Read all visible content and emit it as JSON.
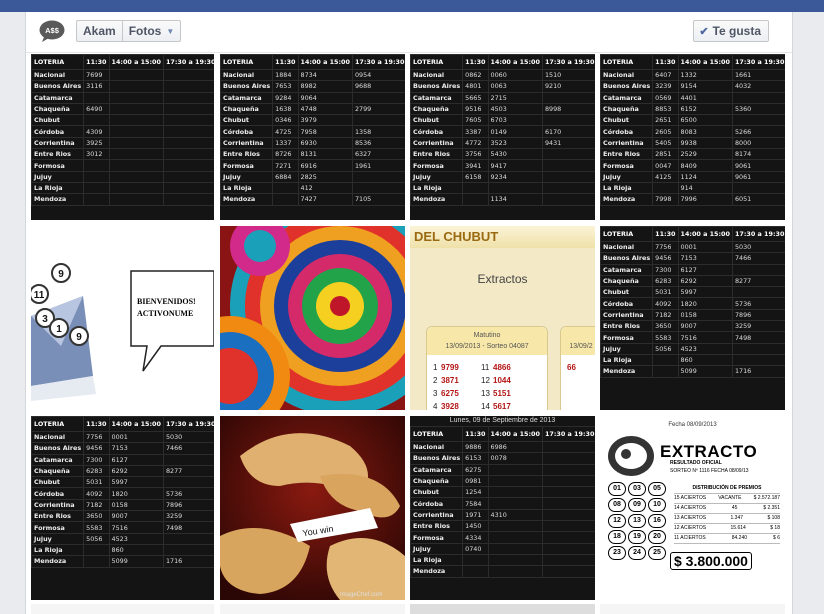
{
  "header": {
    "logo_text": "A$$",
    "page_name": "Akam",
    "section": "Fotos",
    "like_label": "Te gusta"
  },
  "lottery_header": [
    "LOTERIA",
    "11:30",
    "14:00 a 15:00",
    "17:30 a 19:30",
    "21:00 a 22:30"
  ],
  "lottery_tables": [
    {
      "rows": [
        [
          "Nacional",
          "7699",
          "",
          "",
          ""
        ],
        [
          "Buenos Aires",
          "3116",
          "",
          "",
          ""
        ],
        [
          "Catamarca",
          "",
          "",
          "",
          ""
        ],
        [
          "Chaqueña",
          "6490",
          "",
          "",
          ""
        ],
        [
          "Chubut",
          "",
          "",
          "",
          ""
        ],
        [
          "Córdoba",
          "4309",
          "",
          "",
          ""
        ],
        [
          "Corrientina",
          "3925",
          "",
          "",
          ""
        ],
        [
          "Entre Rios",
          "3012",
          "",
          "",
          ""
        ],
        [
          "Formosa",
          "",
          "",
          "",
          ""
        ],
        [
          "Jujuy",
          "",
          "",
          "",
          ""
        ],
        [
          "La Rioja",
          "",
          "",
          "",
          ""
        ],
        [
          "Mendoza",
          "",
          "",
          "",
          ""
        ]
      ]
    },
    {
      "rows": [
        [
          "Nacional",
          "1884",
          "8734",
          "0954",
          "2289"
        ],
        [
          "Buenos Aires",
          "7653",
          "8982",
          "9688",
          "1701"
        ],
        [
          "Catamarca",
          "9284",
          "9064",
          "",
          "7698"
        ],
        [
          "Chaqueña",
          "1638",
          "4748",
          "2799",
          "4817"
        ],
        [
          "Chubut",
          "0346",
          "3979",
          "",
          "8611"
        ],
        [
          "Córdoba",
          "4725",
          "7958",
          "1358",
          "16749"
        ],
        [
          "Corrientina",
          "1337",
          "6930",
          "8536",
          "8021"
        ],
        [
          "Entre Rios",
          "8726",
          "8131",
          "6327",
          "4035"
        ],
        [
          "Formosa",
          "7271",
          "6916",
          "1961",
          "9540"
        ],
        [
          "Jujuy",
          "6884",
          "2825",
          "",
          "1557"
        ],
        [
          "La Rioja",
          "",
          "412",
          "",
          "311"
        ],
        [
          "Mendoza",
          "",
          "7427",
          "7105",
          "0293"
        ]
      ]
    },
    {
      "rows": [
        [
          "Nacional",
          "0862",
          "0060",
          "1510",
          "3221"
        ],
        [
          "Buenos Aires",
          "4801",
          "0063",
          "9210",
          "6784"
        ],
        [
          "Catamarca",
          "5665",
          "2715",
          "",
          "6085"
        ],
        [
          "Chaqueña",
          "9516",
          "4503",
          "8998",
          "5519"
        ],
        [
          "Chubut",
          "7605",
          "6703",
          "",
          "1828"
        ],
        [
          "Córdoba",
          "3387",
          "0149",
          "6170",
          "2385"
        ],
        [
          "Corrientina",
          "4772",
          "3523",
          "9431",
          "4990"
        ],
        [
          "Entre Rios",
          "3756",
          "5430",
          "",
          "7803"
        ],
        [
          "Formosa",
          "3941",
          "9417",
          "",
          "9993"
        ],
        [
          "Jujuy",
          "6158",
          "9234",
          "",
          "8112"
        ],
        [
          "La Rioja",
          "",
          "",
          "",
          "0800"
        ],
        [
          "Mendoza",
          "",
          "1134",
          "",
          "3918"
        ]
      ]
    },
    {
      "rows": [
        [
          "Nacional",
          "6407",
          "1332",
          "1661",
          "9012"
        ],
        [
          "Buenos Aires",
          "3239",
          "9154",
          "4032",
          "9713"
        ],
        [
          "Catamarca",
          "0569",
          "4401",
          "",
          "2172"
        ],
        [
          "Chaqueña",
          "8853",
          "6152",
          "5360",
          "9044"
        ],
        [
          "Chubut",
          "2651",
          "6500",
          "",
          "6361"
        ],
        [
          "Córdoba",
          "2605",
          "8083",
          "5266",
          "9347"
        ],
        [
          "Corrientina",
          "5405",
          "9938",
          "8000",
          "0393"
        ],
        [
          "Entre Rios",
          "2851",
          "2529",
          "8174",
          "0373"
        ],
        [
          "Formosa",
          "0047",
          "8409",
          "9061",
          "1523"
        ],
        [
          "Jujuy",
          "4125",
          "1124",
          "9061",
          "4860"
        ],
        [
          "La Rioja",
          "",
          "914",
          "",
          "662"
        ],
        [
          "Mendoza",
          "7998",
          "7996",
          "6051",
          "4661"
        ]
      ]
    },
    {
      "rows": [
        [
          "Nacional",
          "7756",
          "0001",
          "5030",
          "0392"
        ],
        [
          "Buenos Aires",
          "9456",
          "7153",
          "7466",
          "9185"
        ],
        [
          "Catamarca",
          "7300",
          "6127",
          "",
          "7880"
        ],
        [
          "Chaqueña",
          "6283",
          "6292",
          "8277",
          "4912"
        ],
        [
          "Chubut",
          "5031",
          "5997",
          "",
          "7699"
        ],
        [
          "Córdoba",
          "4092",
          "1820",
          "5736",
          "32055"
        ],
        [
          "Corrientina",
          "7182",
          "0158",
          "7896",
          "4338"
        ],
        [
          "Entre Rios",
          "3650",
          "9007",
          "3259",
          "8434"
        ],
        [
          "Formosa",
          "5583",
          "7516",
          "7498",
          "9692"
        ],
        [
          "Jujuy",
          "5056",
          "4523",
          "",
          "0943"
        ],
        [
          "La Rioja",
          "",
          "860",
          "",
          "482"
        ],
        [
          "Mendoza",
          "",
          "5099",
          "1716",
          "5101"
        ]
      ]
    },
    {
      "rows": [
        [
          "Nacional",
          "7756",
          "0001",
          "5030",
          "0392"
        ],
        [
          "Buenos Aires",
          "9456",
          "7153",
          "7466",
          "9185"
        ],
        [
          "Catamarca",
          "7300",
          "6127",
          "",
          "7880"
        ],
        [
          "Chaqueña",
          "6283",
          "6292",
          "8277",
          "4912"
        ],
        [
          "Chubut",
          "5031",
          "5997",
          "",
          "7699"
        ],
        [
          "Córdoba",
          "4092",
          "1820",
          "5736",
          "32055"
        ],
        [
          "Corrientina",
          "7182",
          "0158",
          "7896",
          "4338"
        ],
        [
          "Entre Rios",
          "3650",
          "9007",
          "3259",
          "8434"
        ],
        [
          "Formosa",
          "5583",
          "7516",
          "7498",
          "9692"
        ],
        [
          "Jujuy",
          "5056",
          "4523",
          "",
          "0943"
        ],
        [
          "La Rioja",
          "",
          "860",
          "",
          "482"
        ],
        [
          "Mendoza",
          "",
          "5099",
          "1716",
          "5101"
        ]
      ]
    },
    {
      "date": "Lunes, 09 de Septiembre de 2013",
      "rows": [
        [
          "Nacional",
          "9886",
          "6986",
          "",
          ""
        ],
        [
          "Buenos Aires",
          "6153",
          "0078",
          "",
          ""
        ],
        [
          "Catamarca",
          "6275",
          "",
          "",
          ""
        ],
        [
          "Chaqueña",
          "0981",
          "",
          "",
          ""
        ],
        [
          "Chubut",
          "1254",
          "",
          "",
          ""
        ],
        [
          "Córdoba",
          "7584",
          "",
          "",
          ""
        ],
        [
          "Corrientina",
          "1971",
          "4310",
          "",
          ""
        ],
        [
          "Entre Rios",
          "1450",
          "",
          "",
          ""
        ],
        [
          "Formosa",
          "4334",
          "",
          "",
          ""
        ],
        [
          "Jujuy",
          "0740",
          "",
          "",
          ""
        ],
        [
          "La Rioja",
          "",
          "",
          "",
          ""
        ],
        [
          "Mendoza",
          "",
          "",
          "",
          ""
        ]
      ]
    }
  ],
  "envelope": {
    "line1": "BIENVENIDOS!",
    "line2": "ACTIVONUME",
    "balls": [
      "9",
      "11",
      "3",
      "1",
      "9"
    ]
  },
  "chubut": {
    "title": "DEL CHUBUT",
    "extractos": "Extractos",
    "card_title": "Matutino",
    "card_date": "13/09/2013 - Sorteo 04087",
    "rows": [
      [
        "1",
        "9799",
        "11",
        "4866"
      ],
      [
        "2",
        "3871",
        "12",
        "1044"
      ],
      [
        "3",
        "6275",
        "13",
        "5151"
      ],
      [
        "4",
        "3928",
        "14",
        "5617"
      ]
    ],
    "card2_date": "13/09/2",
    "card2_num": "66"
  },
  "cookie": {
    "text": "You win",
    "credit": "ImageChef.com"
  },
  "extracto": {
    "fecha": "Fecha 08/09/2013",
    "title": "EXTRACTO",
    "subtitle": "RESULTADO OFICIAL",
    "sorteo": "SORTEO Nº 1116  FECHA 08/09/13",
    "numbers": [
      "01",
      "03",
      "05",
      "08",
      "09",
      "10",
      "12",
      "13",
      "16",
      "18",
      "19",
      "20",
      "23",
      "24",
      "25"
    ],
    "dist_title": "DISTRIBUCIÓN DE PREMIOS",
    "dist": [
      [
        "15 ACIERTOS",
        "VACANTE",
        "$ 2.572.187"
      ],
      [
        "14 ACIERTOS",
        "45",
        "$ 2.351"
      ],
      [
        "13 ACIERTOS",
        "1.347",
        "$ 108"
      ],
      [
        "12 ACIERTOS",
        "15.614",
        "$ 18"
      ],
      [
        "11 ACIERTOS",
        "84.240",
        "$ 6"
      ]
    ],
    "prize": "$ 3.800.000"
  }
}
